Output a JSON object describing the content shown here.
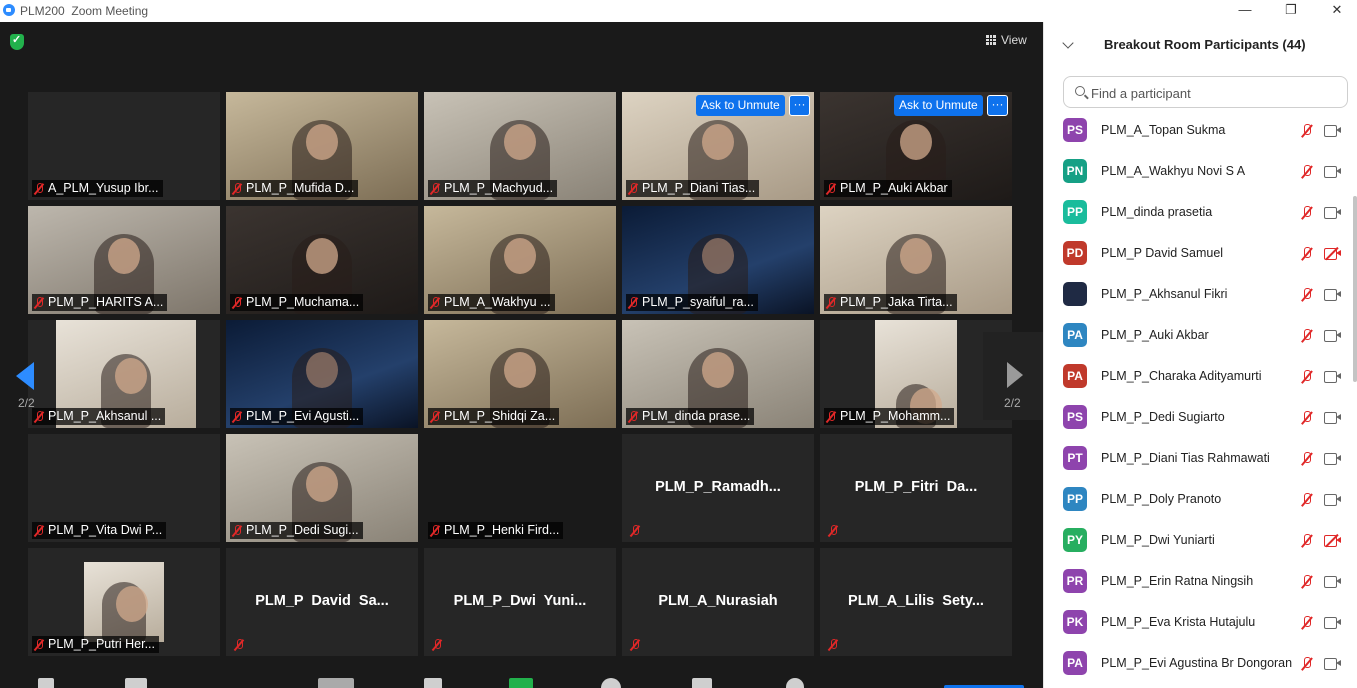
{
  "window": {
    "app_name": "PLM200",
    "title": "Zoom Meeting",
    "minimize_glyph": "—",
    "restore_glyph": "❐",
    "close_glyph": "✕"
  },
  "video": {
    "view_label": "View",
    "unmute_label": "Ask to Unmute",
    "more_glyph": "···",
    "page_left": "2/2",
    "page_right": "2/2",
    "tiles": [
      [
        "A_PLM_Yusup Ibr...",
        "PLM_P_Mufida D...",
        "PLM_P_Machyud...",
        "PLM_P_Diani Tias...",
        "PLM_P_Auki Akbar"
      ],
      [
        "PLM_P_HARITS A...",
        "PLM_P_Muchama...",
        "PLM_A_Wakhyu ...",
        "PLM_P_syaiful_ra...",
        "PLM_P_Jaka Tirta..."
      ],
      [
        "PLM_P_Akhsanul ...",
        "PLM_P_Evi Agusti...",
        "PLM_P_Shidqi Za...",
        "PLM_dinda prase...",
        "PLM_P_Mohamm..."
      ],
      [
        "PLM_P_Vita Dwi P...",
        "PLM_P_Dedi Sugi...",
        "PLM_P_Henki Fird...",
        "",
        ""
      ],
      [
        "PLM_P_Putri Her...",
        "",
        "",
        "",
        ""
      ]
    ],
    "center_names": {
      "r4c4": "PLM_P_Ramadh...",
      "r4c5": "PLM_P_Fitri  Da...",
      "r5c2": "PLM_P  David  Sa...",
      "r5c3": "PLM_P_Dwi  Yuni...",
      "r5c4": "PLM_A_Nurasiah",
      "r5c5": "PLM_A_Lilis  Sety..."
    }
  },
  "panel": {
    "title": "Breakout Room Participants (44)",
    "search_placeholder": "Find a participant",
    "participants": [
      {
        "initials": "PS",
        "name": "PLM_A_Topan Sukma",
        "color": "#8e44ad",
        "camera": "on"
      },
      {
        "initials": "PN",
        "name": "PLM_A_Wakhyu Novi S A",
        "color": "#16a085",
        "camera": "on"
      },
      {
        "initials": "PP",
        "name": "PLM_dinda prasetia",
        "color": "#1abc9c",
        "camera": "on"
      },
      {
        "initials": "PD",
        "name": "PLM_P David Samuel",
        "color": "#c0392b",
        "camera": "off"
      },
      {
        "initials": "",
        "name": "PLM_P_Akhsanul Fikri",
        "color": "#1f2a44",
        "camera": "on"
      },
      {
        "initials": "PA",
        "name": "PLM_P_Auki Akbar",
        "color": "#2e86c1",
        "camera": "on"
      },
      {
        "initials": "PA",
        "name": "PLM_P_Charaka Adityamurti",
        "color": "#c0392b",
        "camera": "on"
      },
      {
        "initials": "PS",
        "name": "PLM_P_Dedi Sugiarto",
        "color": "#8e44ad",
        "camera": "on"
      },
      {
        "initials": "PT",
        "name": "PLM_P_Diani Tias Rahmawati",
        "color": "#8e44ad",
        "camera": "on"
      },
      {
        "initials": "PP",
        "name": "PLM_P_Doly Pranoto",
        "color": "#2e86c1",
        "camera": "on"
      },
      {
        "initials": "PY",
        "name": "PLM_P_Dwi Yuniarti",
        "color": "#27ae60",
        "camera": "off"
      },
      {
        "initials": "PR",
        "name": "PLM_P_Erin Ratna Ningsih",
        "color": "#8e44ad",
        "camera": "on"
      },
      {
        "initials": "PK",
        "name": "PLM_P_Eva Krista Hutajulu",
        "color": "#8e44ad",
        "camera": "on"
      },
      {
        "initials": "PA",
        "name": "PLM_P_Evi Agustina Br Dongoran",
        "color": "#8e44ad",
        "camera": "on"
      }
    ]
  }
}
